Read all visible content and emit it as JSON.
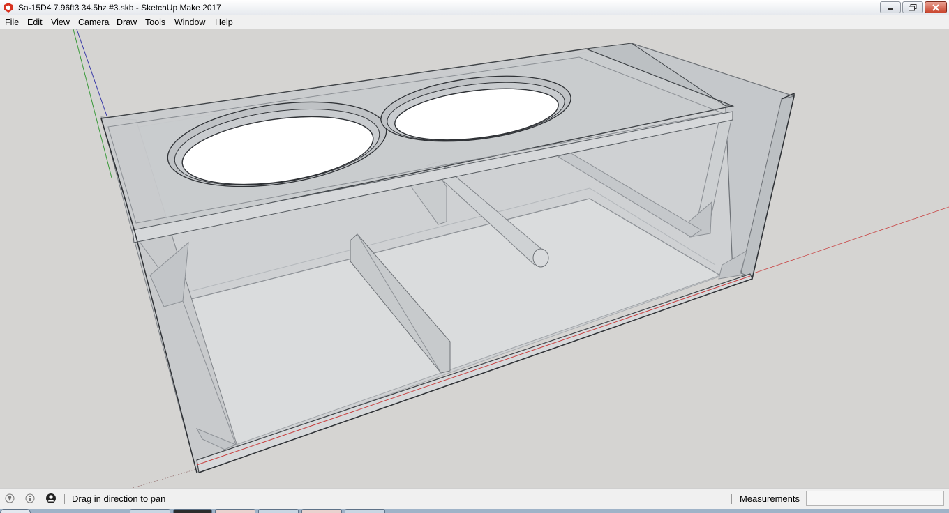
{
  "window": {
    "title": "Sa-15D4 7.96ft3 34.5hz #3.skb - SketchUp Make 2017",
    "icons": {
      "app": "sketchup-logo-icon",
      "minimize": "minimize-icon",
      "maximize": "maximize-icon",
      "close": "close-icon"
    }
  },
  "menu": {
    "items": [
      "File",
      "Edit",
      "View",
      "Camera",
      "Draw",
      "Tools",
      "Window",
      "Help"
    ]
  },
  "status": {
    "message": "Drag in direction to pan",
    "measurements_label": "Measurements",
    "measurements_value": "",
    "icons": [
      "geo-location-icon",
      "credits-icon",
      "user-account-icon"
    ]
  },
  "colors": {
    "accent_close": "#c9452d",
    "red_axis": "#c84040",
    "green_axis": "#3a9a3a",
    "blue_axis": "#3a3aa8",
    "viewport_bg": "#d5d4d2"
  }
}
